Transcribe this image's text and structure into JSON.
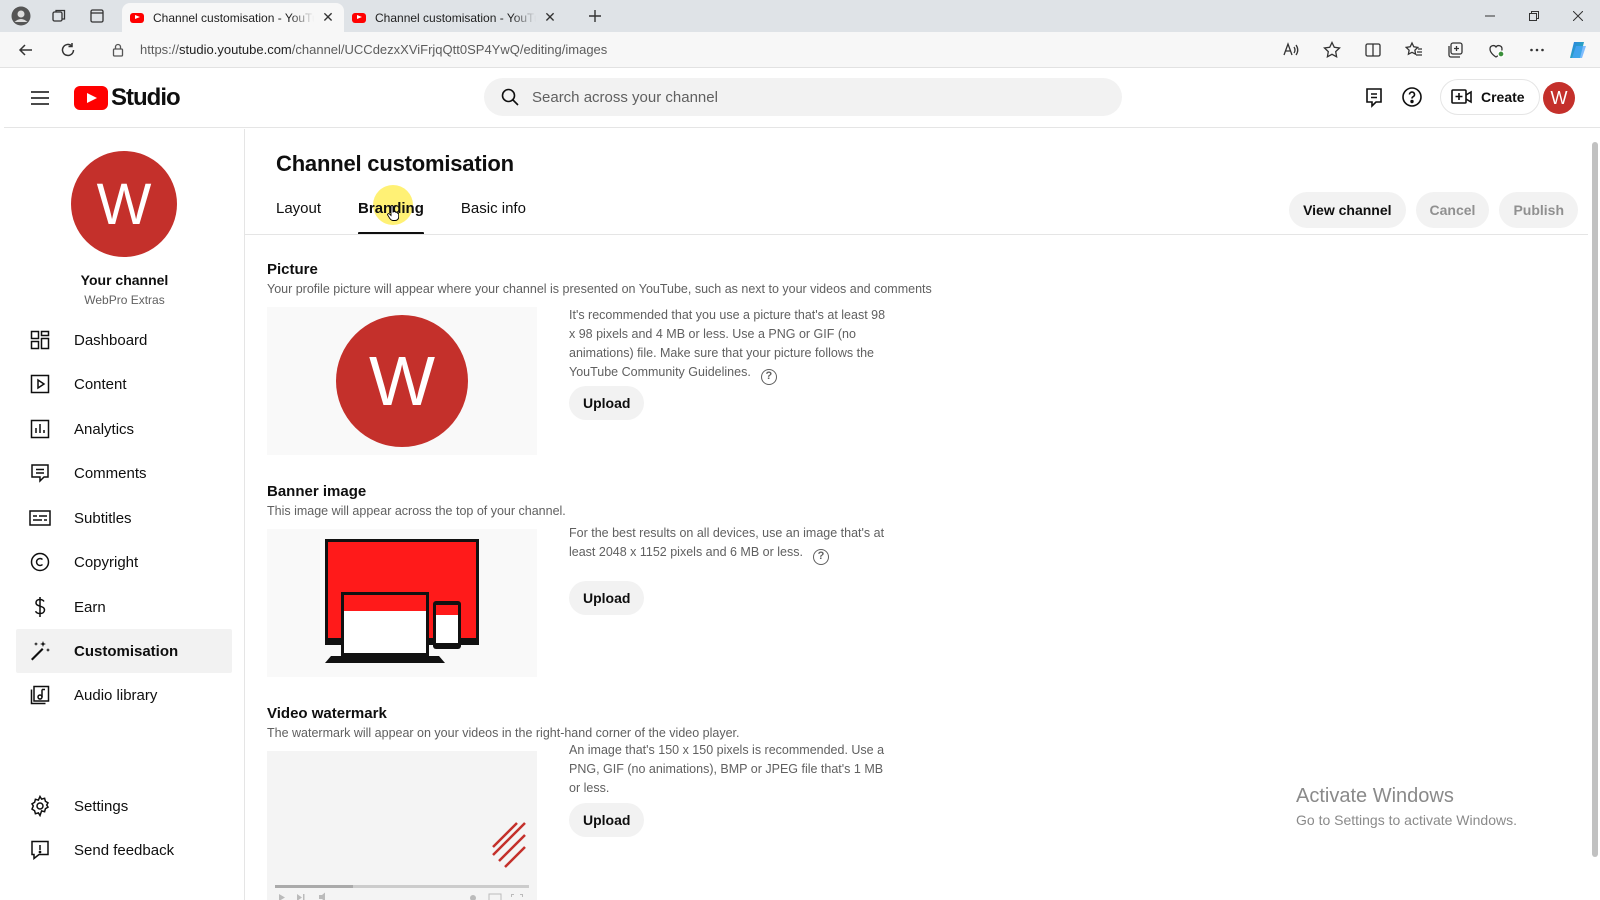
{
  "browser": {
    "tabs": [
      {
        "title": "Channel customisation - YouTube Studio"
      },
      {
        "title": "Channel customisation - YouTube Studio"
      }
    ],
    "url_prefix": "https://",
    "url_host": "studio.youtube.com",
    "url_path": "/channel/UCCdezxXViFrjqQtt0SP4YwQ/editing/images"
  },
  "header": {
    "logo_text": "Studio",
    "search_placeholder": "Search across your channel",
    "create_label": "Create",
    "avatar_letter": "W"
  },
  "sidebar": {
    "avatar_letter": "W",
    "channel_title": "Your channel",
    "channel_name": "WebPro Extras",
    "items": [
      {
        "label": "Dashboard"
      },
      {
        "label": "Content"
      },
      {
        "label": "Analytics"
      },
      {
        "label": "Comments"
      },
      {
        "label": "Subtitles"
      },
      {
        "label": "Copyright"
      },
      {
        "label": "Earn"
      },
      {
        "label": "Customisation"
      },
      {
        "label": "Audio library"
      }
    ],
    "bottom_items": [
      {
        "label": "Settings"
      },
      {
        "label": "Send feedback"
      }
    ]
  },
  "main": {
    "title": "Channel customisation",
    "tabs": [
      {
        "label": "Layout"
      },
      {
        "label": "Branding"
      },
      {
        "label": "Basic info"
      }
    ],
    "actions": {
      "view_channel": "View channel",
      "cancel": "Cancel",
      "publish": "Publish"
    },
    "picture": {
      "title": "Picture",
      "description": "Your profile picture will appear where your channel is presented on YouTube, such as next to your videos and comments",
      "info": "It's recommended that you use a picture that's at least 98 x 98 pixels and 4 MB or less. Use a PNG or GIF (no animations) file. Make sure that your picture follows the YouTube Community Guidelines.",
      "preview_letter": "W",
      "upload": "Upload"
    },
    "banner": {
      "title": "Banner image",
      "description": "This image will appear across the top of your channel.",
      "info": "For the best results on all devices, use an image that's at least 2048 x 1152 pixels and 6 MB or less.",
      "upload": "Upload"
    },
    "watermark": {
      "title": "Video watermark",
      "description": "The watermark will appear on your videos in the right-hand corner of the video player.",
      "info": "An image that's 150 x 150 pixels is recommended. Use a PNG, GIF (no animations), BMP or JPEG file that's 1 MB or less.",
      "upload": "Upload"
    }
  },
  "os": {
    "activate_title": "Activate Windows",
    "activate_sub": "Go to Settings to activate Windows."
  },
  "colors": {
    "accent": "#ff0000",
    "avatar": "#c4302b"
  }
}
